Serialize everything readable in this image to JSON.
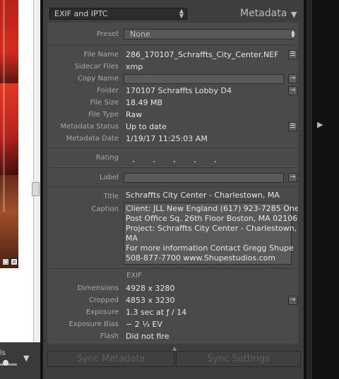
{
  "left": {
    "tools_label": "ls",
    "arrow_icon": "triangle-down-icon"
  },
  "header": {
    "panel_mode": "EXIF and IPTC",
    "panel_title": "Metadata"
  },
  "preset": {
    "label": "Preset",
    "value": "None"
  },
  "file": {
    "file_name_label": "File Name",
    "file_name": "286_170107_Schraffts_City_Center.NEF",
    "sidecar_label": "Sidecar Files",
    "sidecar": "xmp",
    "copy_name_label": "Copy Name",
    "copy_name": "",
    "folder_label": "Folder",
    "folder": "170107 Schraffts Lobby D4",
    "file_size_label": "File Size",
    "file_size": "18.49 MB",
    "file_type_label": "File Type",
    "file_type": "Raw",
    "metadata_status_label": "Metadata Status",
    "metadata_status": "Up to date",
    "metadata_date_label": "Metadata Date",
    "metadata_date": "1/19/17 11:25:03 AM"
  },
  "rating": {
    "label": "Rating",
    "value": ". . . . ."
  },
  "label_row": {
    "label": "Label",
    "value": ""
  },
  "iptc": {
    "title_label": "Title",
    "title": "Schraffts City Center  - Charlestown, MA",
    "caption_label": "Caption",
    "caption_lines": [
      "Client: JLL New England (617) 923-7285 One",
      "Post Office Sq. 26th Floor Boston, MA 02106",
      "Project: Schraffts City Center - Charlestown,",
      "MA",
      "For more information Contact Gregg Shupe",
      "508-877-7700 www.Shupestudios.com"
    ]
  },
  "exif": {
    "heading": "EXIF",
    "dimensions_label": "Dimensions",
    "dimensions": "4928 x 3280",
    "cropped_label": "Cropped",
    "cropped": "4853 x 3230",
    "exposure_label": "Exposure",
    "exposure": "1.3 sec at ƒ / 14",
    "exposure_bias_label": "Exposure Bias",
    "exposure_bias": "− 2 ⅓ EV",
    "flash_label": "Flash",
    "flash": "Did not fire"
  },
  "footer": {
    "sync_metadata": "Sync Metadata",
    "sync_settings": "Sync Settings"
  }
}
